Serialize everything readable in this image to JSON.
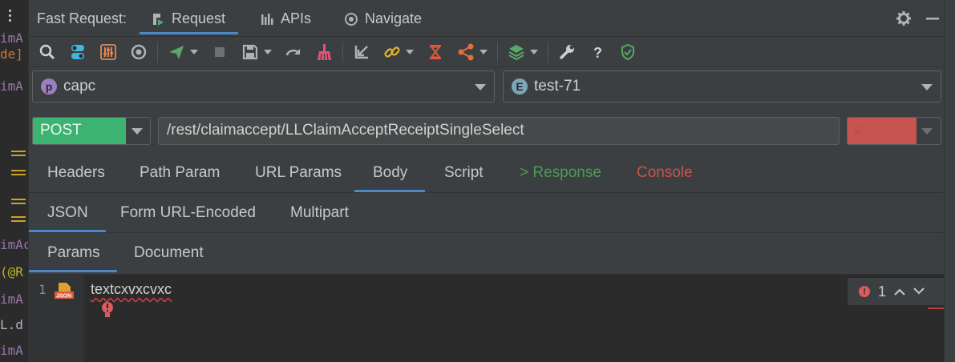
{
  "header": {
    "title": "Fast Request:",
    "tabs": [
      {
        "label": "Request",
        "icon": "request-icon",
        "active": true
      },
      {
        "label": "APIs",
        "icon": "apis-icon",
        "active": false
      },
      {
        "label": "Navigate",
        "icon": "navigate-icon",
        "active": false
      }
    ],
    "right_icons": [
      "gear-icon",
      "minimize-icon"
    ]
  },
  "toolbar": {
    "icons": [
      "search-icon",
      "toggle-icon",
      "equalizer-icon",
      "target-icon",
      "send-icon",
      "stop-icon",
      "save-icon",
      "redo-icon",
      "broom-icon",
      "import-icon",
      "link-icon",
      "hourglass-icon",
      "share-icon",
      "layers-icon",
      "wrench-icon",
      "help-icon",
      "shield-check-icon"
    ]
  },
  "project_select": {
    "badge": "p",
    "value": "capc"
  },
  "env_select": {
    "badge": "E",
    "value": "test-71"
  },
  "request": {
    "method": "POST",
    "url": "/rest/claimaccept/LLClaimAcceptReceiptSingleSelect",
    "send_label": "□"
  },
  "main_tabs": [
    "Headers",
    "Path Param",
    "URL Params",
    "Body",
    "Script",
    "> Response",
    "Console"
  ],
  "main_tabs_active": "Body",
  "body_tabs": [
    "JSON",
    "Form URL-Encoded",
    "Multipart"
  ],
  "body_tabs_active": "JSON",
  "sub_tabs": [
    "Params",
    "Document"
  ],
  "sub_tabs_active": "Params",
  "editor": {
    "line_number": "1",
    "file_badge": "JSON",
    "code": "textcxvxcvxc",
    "error_count": "1"
  },
  "left_fragments": [
    "imA",
    "de]",
    "imA",
    "imAc",
    "(@R",
    "imA",
    "L.d",
    "imA"
  ],
  "colors": {
    "accent": "#4a88c7",
    "post_green": "#3cb371",
    "send_red": "#c75450",
    "response_green": "#499c54",
    "console_red": "#c75450"
  }
}
